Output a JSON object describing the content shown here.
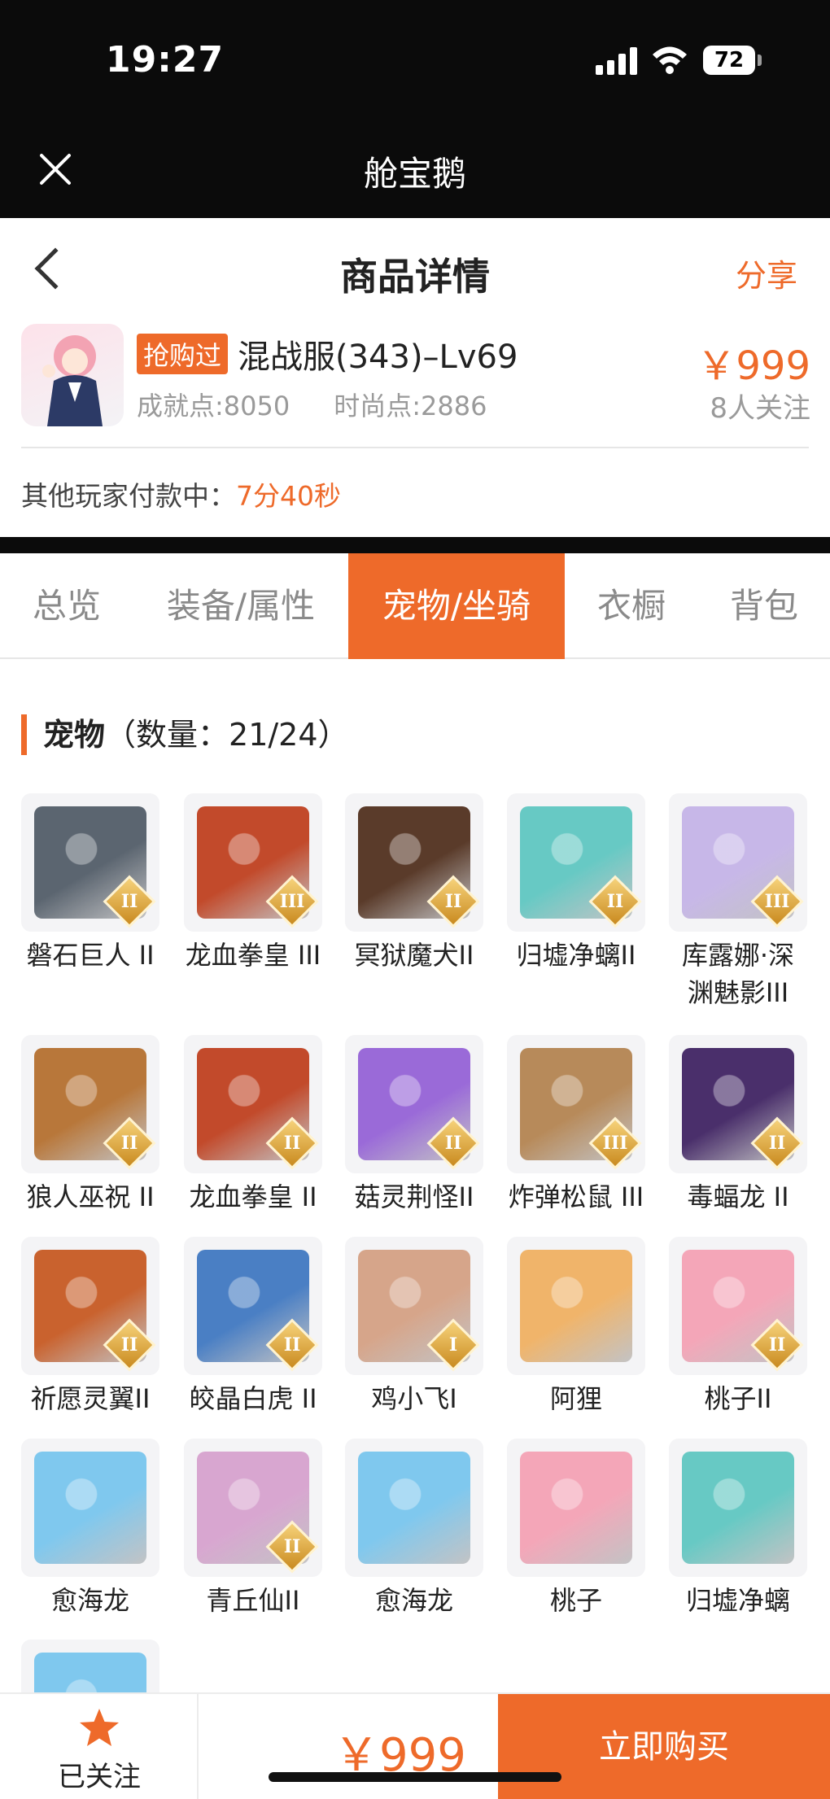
{
  "status_bar": {
    "time": "19:27",
    "battery": "72"
  },
  "app_bar": {
    "title": "舱宝鹅"
  },
  "nav": {
    "title": "商品详情",
    "share": "分享"
  },
  "product": {
    "badge": "抢购过",
    "name": "混战服(343)–Lv69",
    "achievement": "成就点:8050",
    "fashion": "时尚点:2886",
    "price": "￥999",
    "followers": "8人关注"
  },
  "paying": {
    "label": "其他玩家付款中：",
    "countdown": "7分40秒"
  },
  "tabs": [
    {
      "label": "总览",
      "active": false
    },
    {
      "label": "装备/属性",
      "active": false
    },
    {
      "label": "宠物/坐骑",
      "active": true
    },
    {
      "label": "衣橱",
      "active": false
    },
    {
      "label": "背包",
      "active": false
    }
  ],
  "section": {
    "title": "宠物",
    "count": "（数量：21/24）"
  },
  "pets": [
    {
      "name": "磐石巨人 II",
      "tier": "II",
      "color": "#5b6570"
    },
    {
      "name": "龙血拳皇 III",
      "tier": "III",
      "color": "#c24a2b"
    },
    {
      "name": "冥狱魔犬II",
      "tier": "II",
      "color": "#5a3b2a"
    },
    {
      "name": "归墟净螭II",
      "tier": "II",
      "color": "#67c9c4"
    },
    {
      "name": "库露娜·深渊魅影III",
      "tier": "III",
      "color": "#c7b7e8"
    },
    {
      "name": "狼人巫祝 II",
      "tier": "II",
      "color": "#b8773a"
    },
    {
      "name": "龙血拳皇 II",
      "tier": "II",
      "color": "#c24a2b"
    },
    {
      "name": "菇灵荆怪II",
      "tier": "II",
      "color": "#9a6ad8"
    },
    {
      "name": "炸弹松鼠 III",
      "tier": "III",
      "color": "#b78a5a"
    },
    {
      "name": "毒蝠龙 II",
      "tier": "II",
      "color": "#4a2f6b"
    },
    {
      "name": "祈愿灵翼II",
      "tier": "II",
      "color": "#c9622e"
    },
    {
      "name": "皎晶白虎 II",
      "tier": "II",
      "color": "#4a7fc4"
    },
    {
      "name": "鸡小飞I",
      "tier": "I",
      "color": "#d6a58a"
    },
    {
      "name": "阿狸",
      "tier": "",
      "color": "#f0b46a"
    },
    {
      "name": "桃子II",
      "tier": "II",
      "color": "#f4a6b8"
    },
    {
      "name": "愈海龙",
      "tier": "",
      "color": "#7fc8ee"
    },
    {
      "name": "青丘仙II",
      "tier": "II",
      "color": "#d8a6d0"
    },
    {
      "name": "愈海龙",
      "tier": "",
      "color": "#7fc8ee"
    },
    {
      "name": "桃子",
      "tier": "",
      "color": "#f4a6b8"
    },
    {
      "name": "归墟净螭",
      "tier": "",
      "color": "#67c9c4"
    },
    {
      "name": "",
      "tier": "",
      "color": "#7fc8ee"
    }
  ],
  "bottom": {
    "follow": "已关注",
    "price": "￥999",
    "buy": "立即购买"
  },
  "accent_color": "#ee6a2a"
}
